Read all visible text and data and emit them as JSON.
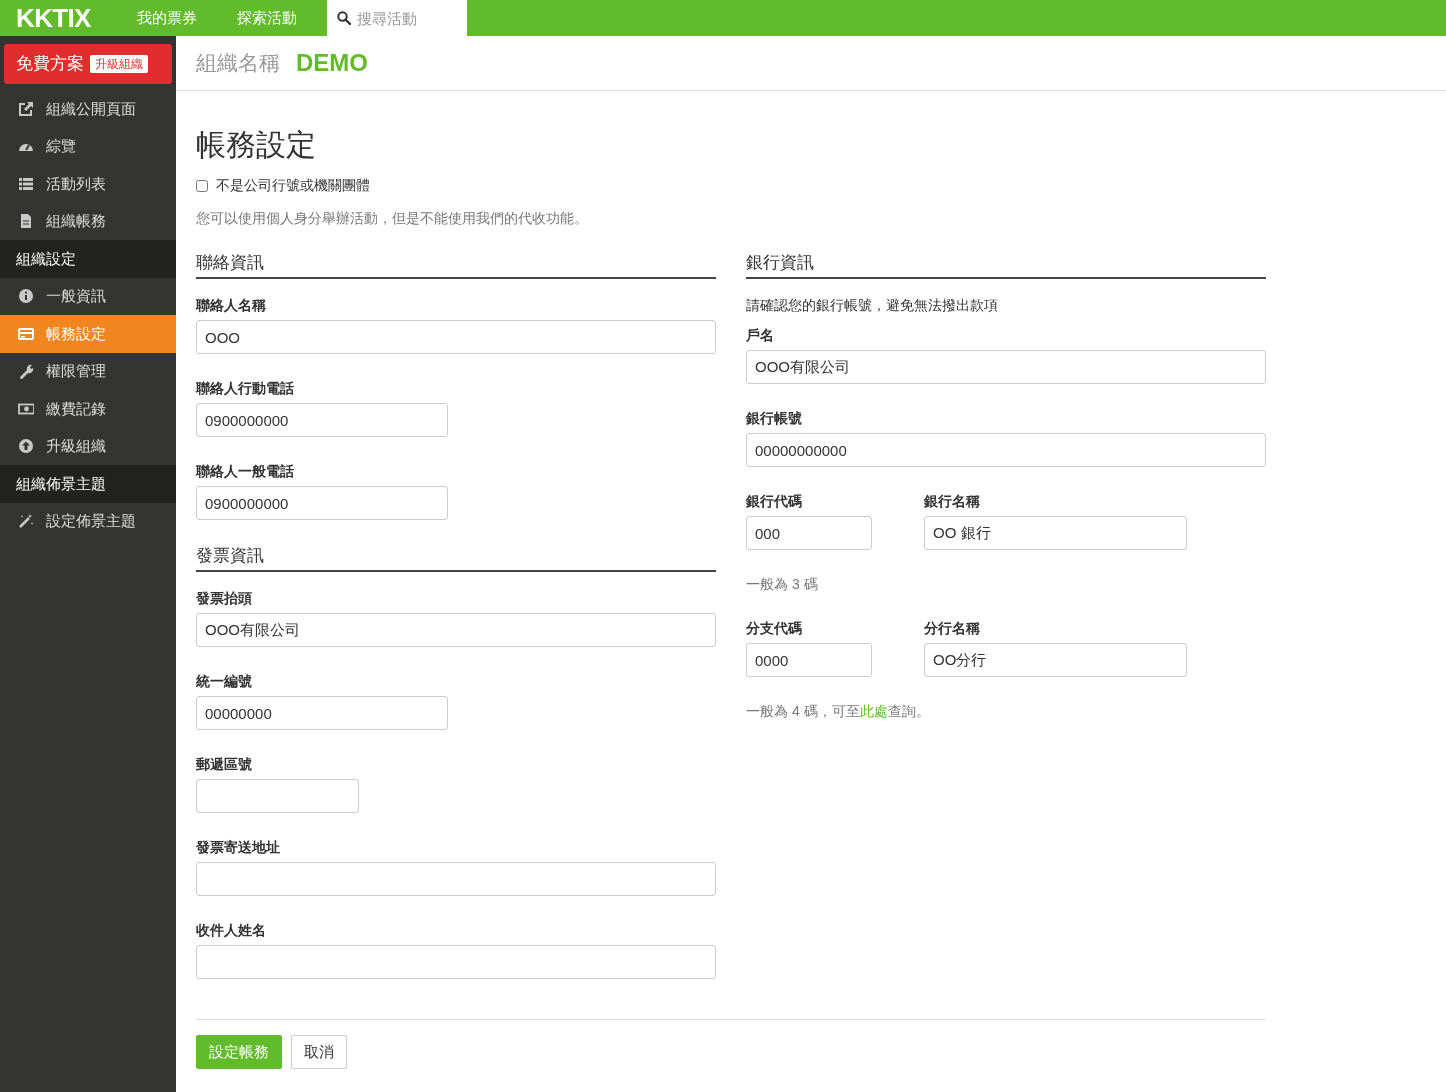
{
  "topbar": {
    "logo": "KKTIX",
    "nav": [
      {
        "label": "我的票券"
      },
      {
        "label": "探索活動"
      }
    ],
    "search": {
      "placeholder": "搜尋活動"
    }
  },
  "sidebar": {
    "plan": {
      "label": "免費方案",
      "badge": "升級組織"
    },
    "items": [
      {
        "kind": "link",
        "label": "組織公開頁面",
        "selected": false
      },
      {
        "kind": "link",
        "label": "綜覽",
        "selected": false
      },
      {
        "kind": "link",
        "label": "活動列表",
        "selected": false
      },
      {
        "kind": "link",
        "label": "組織帳務",
        "selected": false
      },
      {
        "kind": "header",
        "label": "組織設定"
      },
      {
        "kind": "link",
        "label": "一般資訊",
        "selected": false
      },
      {
        "kind": "link",
        "label": "帳務設定",
        "selected": true
      },
      {
        "kind": "link",
        "label": "權限管理",
        "selected": false
      },
      {
        "kind": "link",
        "label": "繳費記錄",
        "selected": false
      },
      {
        "kind": "link",
        "label": "升級組織",
        "selected": false
      },
      {
        "kind": "header",
        "label": "組織佈景主題"
      },
      {
        "kind": "link",
        "label": "設定佈景主題",
        "selected": false
      }
    ]
  },
  "header": {
    "org_label": "組織名稱",
    "org_name": "DEMO"
  },
  "page": {
    "title": "帳務設定",
    "checkbox": {
      "label": "不是公司行號或機關團體",
      "checked": false
    },
    "note": "您可以使用個人身分舉辦活動，但是不能使用我們的代收功能。"
  },
  "contact": {
    "title": "聯絡資訊",
    "fields": [
      {
        "label": "聯絡人名稱",
        "value": "OOO",
        "kind": "wide"
      },
      {
        "label": "聯絡人行動電話",
        "value": "0900000000",
        "kind": "medium"
      },
      {
        "label": "聯絡人一般電話",
        "value": "0900000000",
        "kind": "medium"
      }
    ]
  },
  "invoice": {
    "title": "發票資訊",
    "fields": [
      {
        "label": "發票抬頭",
        "value": "OOO有限公司",
        "kind": "wide"
      },
      {
        "label": "統一編號",
        "value": "00000000",
        "kind": "medium"
      },
      {
        "label": "郵遞區號",
        "kind": "short"
      },
      {
        "label": "發票寄送地址",
        "kind": "wide"
      },
      {
        "label": "收件人姓名",
        "kind": "wide"
      }
    ]
  },
  "bank": {
    "title": "銀行資訊",
    "note": "請確認您的銀行帳號，避免無法撥出款項",
    "fields": [
      {
        "label": "戶名",
        "value": "OOO有限公司"
      },
      {
        "label": "銀行帳號",
        "value": "00000000000"
      }
    ],
    "groups": [
      {
        "code": {
          "label": "銀行代碼",
          "value": "000"
        },
        "name": {
          "label": "銀行名稱",
          "value": "OO 銀行"
        },
        "hint": {
          "text": "一般為 3 碼"
        }
      },
      {
        "code": {
          "label": "分支代碼",
          "value": "0000"
        },
        "name": {
          "label": "分行名稱",
          "value": "OO分行"
        },
        "hint": {
          "text": "一般為 4 碼，可至",
          "link": "此處",
          "after": "查詢。"
        }
      }
    ]
  },
  "actions": [
    {
      "kind": "primary",
      "label": "設定帳務"
    },
    {
      "kind": "secondary",
      "label": "取消"
    }
  ]
}
